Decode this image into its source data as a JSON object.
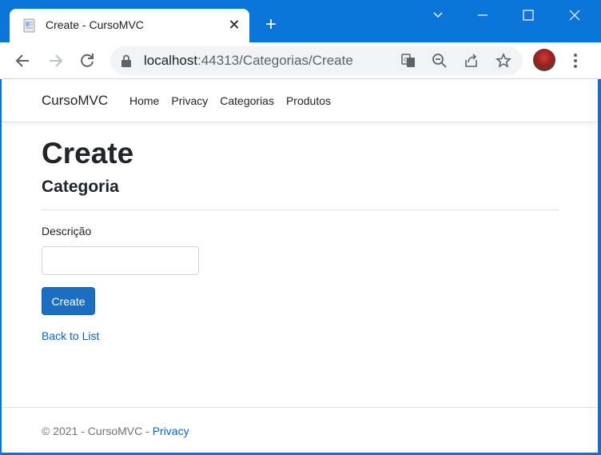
{
  "browser": {
    "tab_title": "Create - CursoMVC",
    "url_host": "localhost",
    "url_rest": ":44313/Categorias/Create"
  },
  "site": {
    "brand": "CursoMVC",
    "nav": [
      "Home",
      "Privacy",
      "Categorias",
      "Produtos"
    ]
  },
  "page": {
    "title": "Create",
    "subtitle": "Categoria",
    "field_label": "Descrição",
    "field_value": "",
    "submit_label": "Create",
    "back_link": "Back to List"
  },
  "footer": {
    "copyright": "© 2021 - CursoMVC - ",
    "privacy_link": "Privacy"
  },
  "colors": {
    "accent": "#1b6ec2",
    "link": "#0366d6",
    "titlebar": "#0b74d8"
  }
}
